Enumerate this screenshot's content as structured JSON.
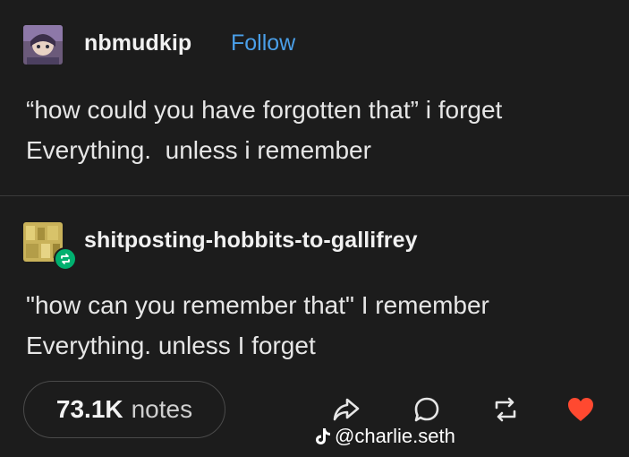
{
  "post1": {
    "username": "nbmudkip",
    "follow_label": "Follow",
    "text": "“how could you have forgotten that” i forget\nEverything.  unless i remember"
  },
  "post2": {
    "username": "shitposting-hobbits-to-gallifrey",
    "text": "\"how can you remember that\" I remember\nEverything. unless I forget"
  },
  "footer": {
    "notes_count": "73.1K",
    "notes_label": "notes",
    "icons": [
      "share-icon",
      "reply-icon",
      "reblog-icon",
      "heart-icon"
    ],
    "like_color": "#ff4930"
  },
  "watermark": {
    "handle": "@charlie.seth",
    "icon": "tiktok-icon"
  },
  "colors": {
    "background": "#1c1c1c",
    "follow": "#4a9fe8",
    "reblog_badge": "#00b06f"
  }
}
